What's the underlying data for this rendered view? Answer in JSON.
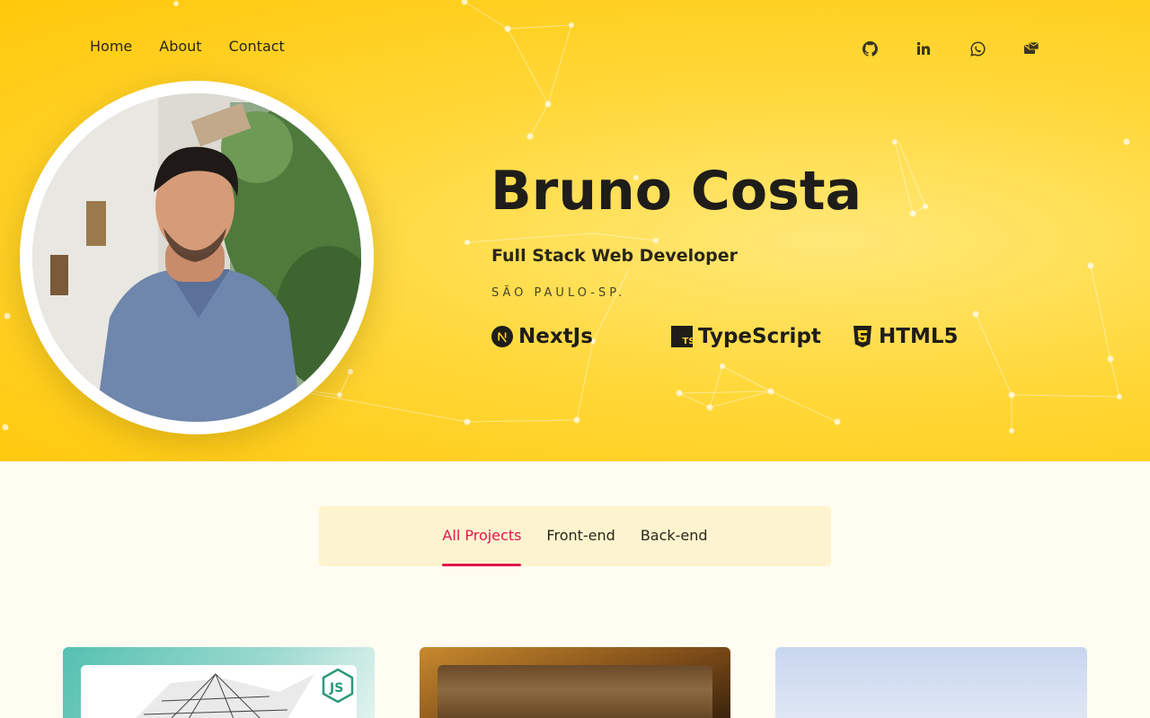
{
  "nav": {
    "items": [
      "Home",
      "About",
      "Contact"
    ]
  },
  "social": [
    {
      "icon": "github-icon"
    },
    {
      "icon": "linkedin-icon"
    },
    {
      "icon": "whatsapp-icon"
    },
    {
      "icon": "mail-icon"
    }
  ],
  "profile": {
    "name": "Bruno Costa",
    "role": "Full Stack Web Developer",
    "location": "SÃO PAULO-SP."
  },
  "skills": [
    {
      "label": "NextJs",
      "icon": "nextjs-icon"
    },
    {
      "label": "TypeScript",
      "icon": "typescript-icon"
    },
    {
      "label": "HTML5",
      "icon": "html5-icon"
    }
  ],
  "tabs": {
    "items": [
      "All Projects",
      "Front-end",
      "Back-end"
    ],
    "active": "All Projects"
  },
  "colors": {
    "hero": "#ffd21f",
    "accent": "#e0164e",
    "page_bg": "#fffcf2",
    "tabs_bg": "#fdf4cf"
  }
}
